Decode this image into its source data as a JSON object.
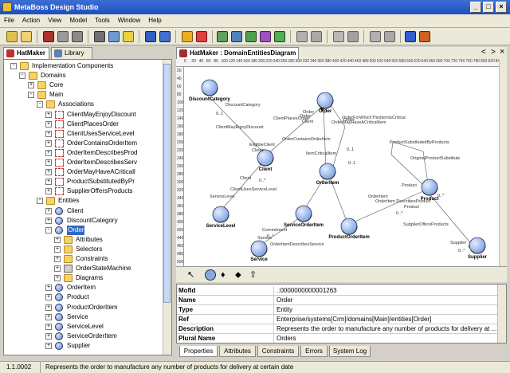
{
  "window": {
    "title": "MetaBoss Design Studio"
  },
  "menu": [
    "File",
    "Action",
    "View",
    "Model",
    "Tools",
    "Window",
    "Help"
  ],
  "left_tabs": [
    "HatMaker",
    "Library"
  ],
  "tree": [
    {
      "depth": 3,
      "expander": "-",
      "icon": "folder",
      "label": "Implementation Components"
    },
    {
      "depth": 4,
      "expander": "-",
      "icon": "folder",
      "label": "Domains"
    },
    {
      "depth": 5,
      "expander": "+",
      "icon": "folder",
      "label": "Core"
    },
    {
      "depth": 5,
      "expander": "-",
      "icon": "folder",
      "label": "Main"
    },
    {
      "depth": 6,
      "expander": "-",
      "icon": "folder",
      "label": "Associations"
    },
    {
      "depth": 7,
      "expander": "+",
      "icon": "assoc",
      "label": "ClientMayEnjoyDiscount"
    },
    {
      "depth": 7,
      "expander": "+",
      "icon": "assoc",
      "label": "ClientPlacesOrder"
    },
    {
      "depth": 7,
      "expander": "+",
      "icon": "assoc",
      "label": "ClientUsesServiceLevel"
    },
    {
      "depth": 7,
      "expander": "+",
      "icon": "assoc",
      "label": "OrderContainsOrderItem"
    },
    {
      "depth": 7,
      "expander": "+",
      "icon": "assoc",
      "label": "OrderItemDescribesProd"
    },
    {
      "depth": 7,
      "expander": "+",
      "icon": "assoc",
      "label": "OrderItemDescribesServ"
    },
    {
      "depth": 7,
      "expander": "+",
      "icon": "assoc",
      "label": "OrderMayHaveACriticall"
    },
    {
      "depth": 7,
      "expander": "+",
      "icon": "assoc",
      "label": "ProductSubstitutedByPr"
    },
    {
      "depth": 7,
      "expander": "+",
      "icon": "assoc",
      "label": "SupplierOffersProducts"
    },
    {
      "depth": 6,
      "expander": "-",
      "icon": "folder",
      "label": "Entities"
    },
    {
      "depth": 7,
      "expander": "+",
      "icon": "entity",
      "label": "Client"
    },
    {
      "depth": 7,
      "expander": "+",
      "icon": "entity",
      "label": "DiscountCategory"
    },
    {
      "depth": 7,
      "expander": "-",
      "icon": "entity",
      "label": "Order",
      "selected": true
    },
    {
      "depth": 8,
      "expander": "+",
      "icon": "folder",
      "label": "Attributes"
    },
    {
      "depth": 8,
      "expander": "+",
      "icon": "folder",
      "label": "Selectors"
    },
    {
      "depth": 8,
      "expander": "+",
      "icon": "folder",
      "label": "Constraints"
    },
    {
      "depth": 8,
      "expander": "+",
      "icon": "sm",
      "label": "OrderStateMachine"
    },
    {
      "depth": 8,
      "expander": "+",
      "icon": "folder",
      "label": "Diagrams"
    },
    {
      "depth": 7,
      "expander": "+",
      "icon": "entity",
      "label": "OrderItem"
    },
    {
      "depth": 7,
      "expander": "+",
      "icon": "entity",
      "label": "Product"
    },
    {
      "depth": 7,
      "expander": "+",
      "icon": "entity",
      "label": "ProductOrderItem"
    },
    {
      "depth": 7,
      "expander": "+",
      "icon": "entity",
      "label": "Service"
    },
    {
      "depth": 7,
      "expander": "+",
      "icon": "entity",
      "label": "ServiceLevel"
    },
    {
      "depth": 7,
      "expander": "+",
      "icon": "entity",
      "label": "ServiceOrderItem"
    },
    {
      "depth": 7,
      "expander": "+",
      "icon": "entity",
      "label": "Supplier"
    }
  ],
  "diagram": {
    "tab_title": "HatMaker : DomainEntitiesDiagram",
    "nav": {
      "prev": "<",
      "next": ">",
      "close": "×"
    },
    "ruler_ticks": [
      "0",
      "20",
      "40",
      "60",
      "80",
      "100",
      "120",
      "140",
      "160",
      "180",
      "200",
      "220",
      "240",
      "260",
      "280",
      "300",
      "320",
      "340",
      "360",
      "380",
      "400",
      "420",
      "440",
      "460",
      "480",
      "500",
      "520",
      "540",
      "560",
      "580",
      "600",
      "620",
      "640",
      "660",
      "680",
      "700",
      "720",
      "740",
      "760",
      "780",
      "800",
      "820",
      "840"
    ],
    "vruler_ticks": [
      "20",
      "40",
      "60",
      "80",
      "100",
      "120",
      "140",
      "160",
      "180",
      "200",
      "220",
      "240",
      "260",
      "280",
      "300",
      "320",
      "340",
      "360",
      "380",
      "400",
      "420",
      "440",
      "460",
      "480",
      "500"
    ],
    "entities": {
      "discount": "DiscountCategory",
      "order": "Order",
      "client": "Client",
      "orderitem": "OrderItem",
      "product": "Product",
      "servicelevel": "ServiceLevel",
      "serviceorderitem": "ServiceOrderItem",
      "productorderitem": "ProductOrderItem",
      "service": "Service",
      "supplier": "Supplier"
    },
    "labels": {
      "discount_category_role": "DiscountCategory",
      "mult_discount": "0..1",
      "client_may_enjoy": "ClientMayEnjoyDiscount",
      "eligible_client": "EligibleClient",
      "client_role": "Client",
      "client_places_order": "ClientPlacesOrder",
      "order_role": "Order",
      "client_role2": "Client",
      "order_contains": "OrderContainsOrderItem",
      "order_role2": "Order",
      "order_may_have": "OrderMayHaveACriticalItem",
      "order_role3": "Order",
      "order_for_which": "OrderForWhichThisItemIsCritical",
      "item_critical": "ItemCriticalItem",
      "mult_01a": "0..1",
      "mult_01b": "0..1",
      "product_substituted": "ProductSubstitutedByProducts",
      "original_product": "OriginalProductSubstitute",
      "mult_0n_a": "0..*",
      "product_role": "Product",
      "client_role3": "Client",
      "client_uses": "ClientUsesServiceLevel",
      "service_level_role": "ServiceLevel",
      "mult_0n_b": "0..*",
      "order_item_role": "OrderItem",
      "order_item_describes_product": "OrderItem DescribesProduct",
      "mult_0n_c": "0..*",
      "product_role2": "Product",
      "supplier_offers": "SupplierOffersProducts",
      "commitment": "Commitment",
      "mult_0n_d": "0..*",
      "service_role": "Service",
      "order_item_describes_service": "OrderItemDescribesService",
      "supplier_role": "Supplier",
      "mult_0n_e": "0..*"
    }
  },
  "properties": [
    {
      "name": "MofId",
      "value": ".:0000000000001263"
    },
    {
      "name": "Name",
      "value": "Order"
    },
    {
      "name": "Type",
      "value": "Entity"
    },
    {
      "name": "Ref",
      "value": "Enterprise/systems[Crm]/domains[Main]/entities[Order]"
    },
    {
      "name": "Description",
      "value": "Represents the order to manufacture any number of products for delivery at ..."
    },
    {
      "name": "Plural Name",
      "value": "Orders"
    }
  ],
  "prop_tabs": [
    "Properties",
    "Attributes",
    "Constraints",
    "Errors",
    "System Log"
  ],
  "status": {
    "version": "1.1.0002",
    "message": "Represents the order to manufacture any number of products for delivery at certain date"
  },
  "colors": {
    "title_bar": "#1d4fbe",
    "selection": "#316ac5",
    "entity_fill": "#9db9ee"
  }
}
